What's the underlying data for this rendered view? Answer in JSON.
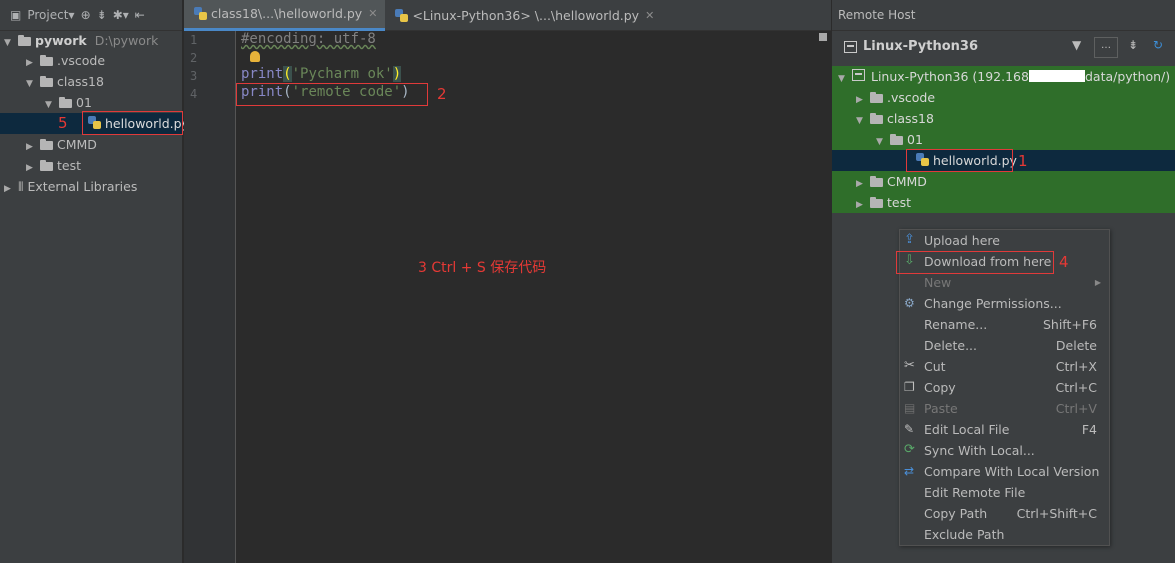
{
  "project_panel": {
    "toolbar": {
      "title": "Project"
    },
    "tree": [
      {
        "label": "pywork",
        "path": "D:\\pywork"
      },
      {
        "label": ".vscode"
      },
      {
        "label": "class18"
      },
      {
        "label": "01"
      },
      {
        "label": "helloworld.py"
      },
      {
        "label": "CMMD"
      },
      {
        "label": "test"
      },
      {
        "label": "External Libraries"
      }
    ]
  },
  "editor": {
    "tabs": [
      {
        "label": "class18\\...\\helloworld.py"
      },
      {
        "label": "<Linux-Python36> \\...\\helloworld.py"
      }
    ],
    "line_numbers": [
      "1",
      "2",
      "3",
      "4"
    ],
    "code": {
      "line1": "#encoding: utf-8",
      "line3_kw": "print",
      "line3_str": "'Pycharm ok'",
      "line4_kw": "print",
      "line4_str": "'remote code'"
    },
    "instruction": "3 Ctrl + S 保存代码"
  },
  "remote_host": {
    "title": "Remote Host",
    "host": "Linux-Python36",
    "tree": [
      {
        "label_start": "Linux-Python36 (192.168",
        "label_end": "data/python/)"
      },
      {
        "label": ".vscode"
      },
      {
        "label": "class18"
      },
      {
        "label": "01"
      },
      {
        "label": "helloworld.py"
      },
      {
        "label": "CMMD"
      },
      {
        "label": "test"
      }
    ]
  },
  "context_menu": {
    "items": [
      {
        "label": "Upload here",
        "shortcut": ""
      },
      {
        "label": "Download from here",
        "shortcut": ""
      },
      {
        "label": "New",
        "shortcut": ""
      },
      {
        "label": "Change Permissions...",
        "shortcut": ""
      },
      {
        "label": "Rename...",
        "shortcut": "Shift+F6"
      },
      {
        "label": "Delete...",
        "shortcut": "Delete"
      },
      {
        "label": "Cut",
        "shortcut": "Ctrl+X"
      },
      {
        "label": "Copy",
        "shortcut": "Ctrl+C"
      },
      {
        "label": "Paste",
        "shortcut": "Ctrl+V"
      },
      {
        "label": "Edit Local File",
        "shortcut": "F4"
      },
      {
        "label": "Sync With Local...",
        "shortcut": ""
      },
      {
        "label": "Compare With Local Version",
        "shortcut": ""
      },
      {
        "label": "Edit Remote File",
        "shortcut": ""
      },
      {
        "label": "Copy Path",
        "shortcut": "Ctrl+Shift+C"
      },
      {
        "label": "Exclude Path",
        "shortcut": ""
      }
    ]
  },
  "annotations": {
    "a1": "1",
    "a2": "2",
    "a4": "4",
    "a5": "5"
  },
  "colors": {
    "accent": "#4a88c7",
    "annotation_red": "#e53935",
    "remote_tree_green": "#2f6e2a",
    "selection": "#0d293e"
  }
}
